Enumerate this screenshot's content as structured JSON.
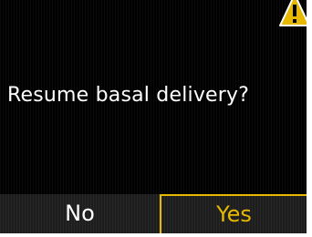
{
  "dialog": {
    "prompt": "Resume basal delivery?"
  },
  "softkeys": {
    "left_label": "No",
    "right_label": "Yes"
  },
  "icons": {
    "status": "warning-triangle-icon"
  },
  "colors": {
    "background": "#000000",
    "text": "#ffffff",
    "accent": "#e6b800"
  }
}
